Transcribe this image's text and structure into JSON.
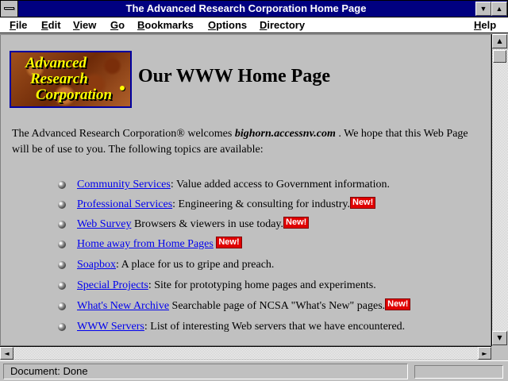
{
  "window": {
    "title": "The Advanced Research Corporation Home Page"
  },
  "menubar": {
    "items": [
      {
        "ul": "F",
        "rest": "ile"
      },
      {
        "ul": "E",
        "rest": "dit"
      },
      {
        "ul": "V",
        "rest": "iew"
      },
      {
        "ul": "G",
        "rest": "o"
      },
      {
        "ul": "B",
        "rest": "ookmarks"
      },
      {
        "ul": "O",
        "rest": "ptions"
      },
      {
        "ul": "D",
        "rest": "irectory"
      },
      {
        "ul": "H",
        "rest": "elp"
      }
    ]
  },
  "logo": {
    "line1": "Advanced",
    "line2": "Research",
    "line3": "Corporation"
  },
  "page": {
    "heading": "Our WWW Home Page",
    "intro_before": "The Advanced Research Corporation® welcomes ",
    "intro_host": "bighorn.accessnv.com",
    "intro_after": " .  We hope that this Web Page will be of use to you.  The following topics are available:"
  },
  "topics": [
    {
      "link": "Community Services",
      "desc": ": Value added access to Government information.",
      "badge": ""
    },
    {
      "link": "Professional Services",
      "desc": ": Engineering & consulting for industry.",
      "badge": "New!"
    },
    {
      "link": "Web Survey",
      "desc": " Browsers & viewers in use today.",
      "badge": "New!"
    },
    {
      "link": "Home away from Home Pages",
      "desc": " ",
      "badge": "New!"
    },
    {
      "link": "Soapbox",
      "desc": ": A place for us to gripe and preach.",
      "badge": ""
    },
    {
      "link": "Special Projects",
      "desc": ": Site for prototyping home pages and experiments.",
      "badge": ""
    },
    {
      "link": "What's New Archive",
      "desc": " Searchable page of NCSA \"What's New\" pages.",
      "badge": "New!"
    },
    {
      "link": "WWW Servers",
      "desc": ": List of interesting Web servers that we have encountered.",
      "badge": ""
    }
  ],
  "status": {
    "text": "Document: Done"
  },
  "icons": {
    "minimize": "▼",
    "maximize": "▲",
    "scroll_up": "▲",
    "scroll_down": "▼",
    "scroll_left": "◄",
    "scroll_right": "►"
  },
  "colors": {
    "titlebar": "#000080",
    "link": "#0000ee",
    "new_badge": "#e00000",
    "logo_text": "#ffff00"
  }
}
